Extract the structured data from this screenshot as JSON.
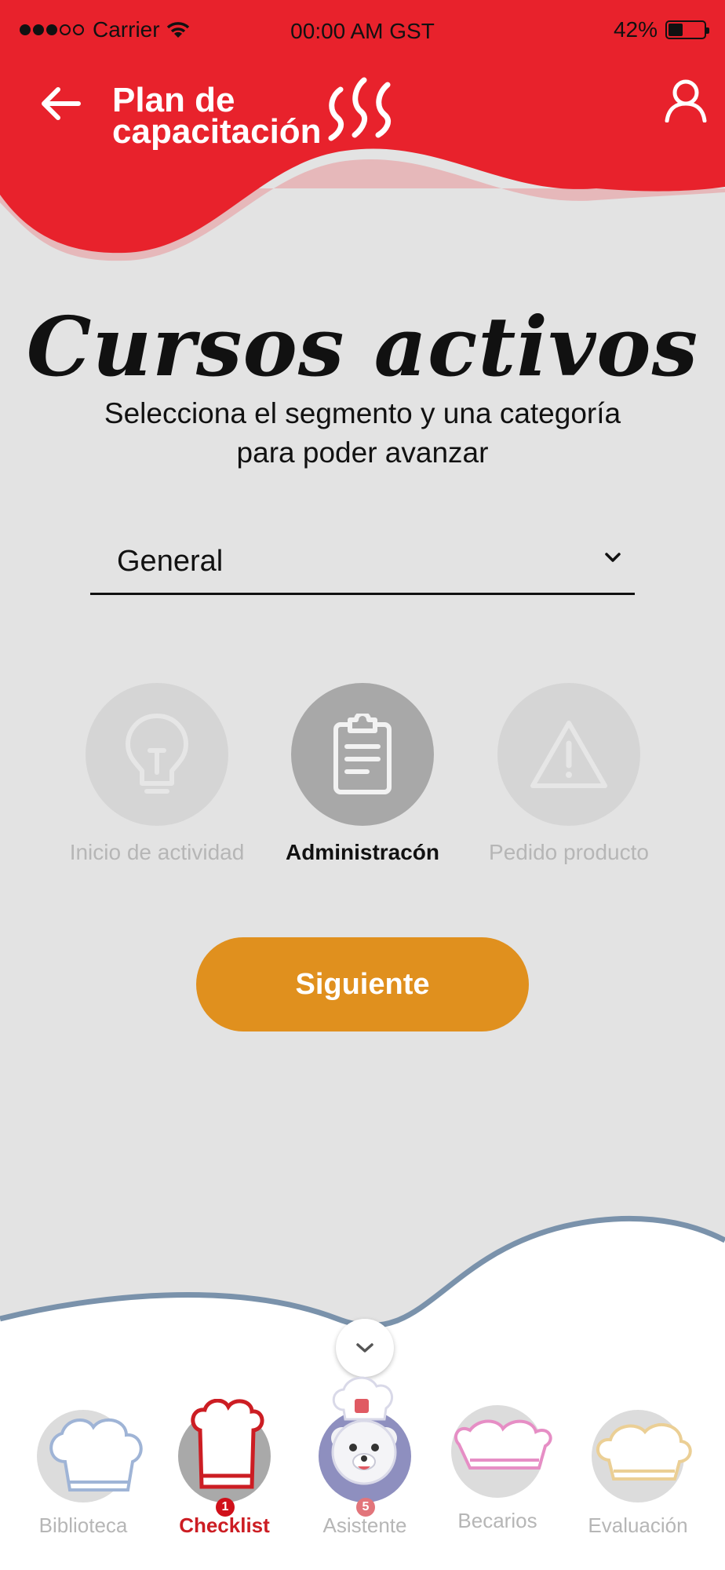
{
  "status_bar": {
    "carrier": "Carrier",
    "time": "00:00 AM GST",
    "battery": "42%"
  },
  "header": {
    "title_line1": "Plan de",
    "title_line2": "capacitación"
  },
  "main": {
    "heading": "Cursos activos",
    "subtitle_line1": "Selecciona el segmento y una categoría",
    "subtitle_line2": "para poder avanzar",
    "segment_select": {
      "value": "General"
    },
    "categories": [
      {
        "label": "Inicio de actividad",
        "icon": "lightbulb-icon",
        "selected": false
      },
      {
        "label": "Administracón",
        "icon": "clipboard-icon",
        "selected": true
      },
      {
        "label": "Pedido producto",
        "icon": "warning-icon",
        "selected": false
      }
    ],
    "next_button": "Siguiente"
  },
  "bottom_nav": {
    "tabs": [
      {
        "label": "Biblioteca",
        "icon": "chef-hat-blue-icon",
        "active": false
      },
      {
        "label": "Checklist",
        "icon": "chef-hat-red-icon",
        "active": true,
        "badge": "1"
      },
      {
        "label": "Asistente",
        "icon": "bear-mascot-icon",
        "active": false,
        "badge": "5"
      },
      {
        "label": "Becarios",
        "icon": "chef-hat-pink-icon",
        "active": false
      },
      {
        "label": "Evaluación",
        "icon": "chef-hat-yellow-icon",
        "active": false
      }
    ]
  },
  "colors": {
    "primary_red": "#e8222c",
    "accent_orange": "#e0901e",
    "background": "#e3e3e3",
    "active_tab": "#cc1d23"
  }
}
